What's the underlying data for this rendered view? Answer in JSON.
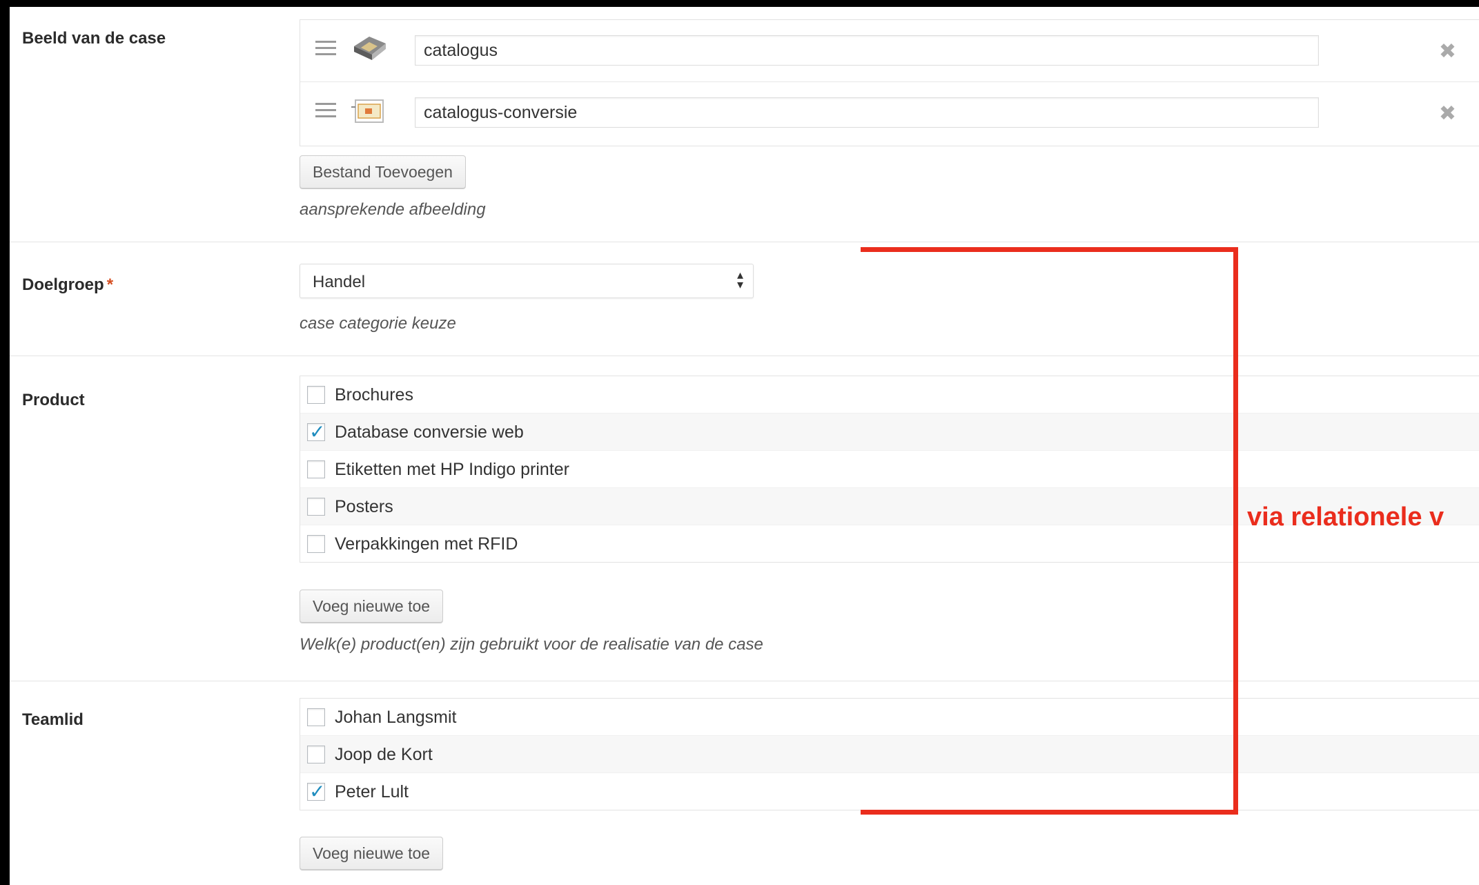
{
  "image_field": {
    "label": "Beeld van de case",
    "files": [
      {
        "value": "catalogus",
        "thumb_icon": "catalogue-thumbnail-icon",
        "remove_glyph": "✖"
      },
      {
        "value": "catalogus-conversie",
        "thumb_icon": "document-thumbnail-icon",
        "remove_glyph": "✖"
      }
    ],
    "add_button": "Bestand Toevoegen",
    "description": "aansprekende afbeelding"
  },
  "doelgroep": {
    "label": "Doelgroep",
    "required_mark": "*",
    "selected": "Handel",
    "description": "case categorie keuze"
  },
  "product": {
    "label": "Product",
    "options": [
      {
        "label": "Brochures",
        "checked": false
      },
      {
        "label": "Database conversie web",
        "checked": true
      },
      {
        "label": "Etiketten met HP Indigo printer",
        "checked": false
      },
      {
        "label": "Posters",
        "checked": false
      },
      {
        "label": "Verpakkingen met RFID",
        "checked": false
      }
    ],
    "add_button": "Voeg nieuwe toe",
    "description": "Welk(e) product(en) zijn gebruikt voor de realisatie van de case"
  },
  "teamlid": {
    "label": "Teamlid",
    "options": [
      {
        "label": "Johan Langsmit",
        "checked": false
      },
      {
        "label": "Joop de Kort",
        "checked": false
      },
      {
        "label": "Peter Lult",
        "checked": true
      }
    ],
    "add_button": "Voeg nieuwe toe"
  },
  "annotation": {
    "text": "via relationele v",
    "color": "#ea2d1d"
  },
  "colors": {
    "check_accent": "#1e8cbe",
    "required": "#d54e21"
  }
}
